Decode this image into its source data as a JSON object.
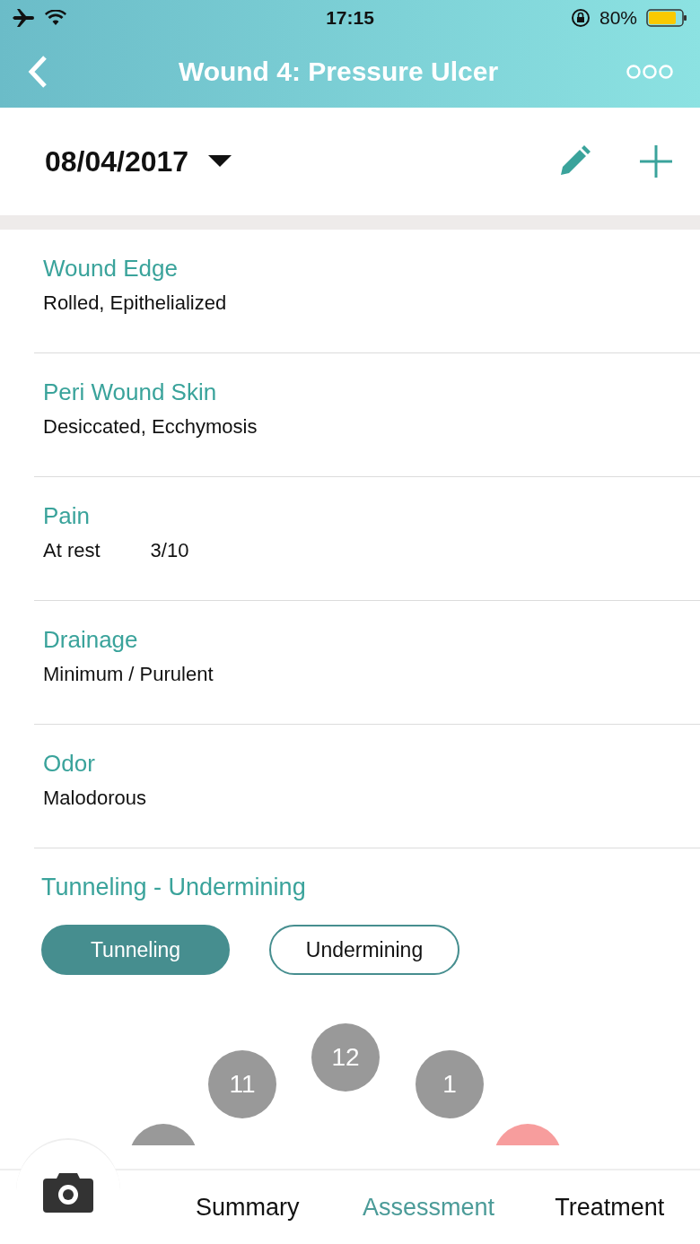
{
  "status_bar": {
    "time": "17:15",
    "battery_text": "80%"
  },
  "nav": {
    "title": "Wound 4: Pressure Ulcer"
  },
  "date_selector": {
    "value": "08/04/2017"
  },
  "fields": [
    {
      "label": "Wound Edge",
      "value": "Rolled, Epithelialized"
    },
    {
      "label": "Peri Wound Skin",
      "value": "Desiccated, Ecchymosis"
    },
    {
      "label": "Pain",
      "value": "At rest",
      "score": "3/10"
    },
    {
      "label": "Drainage",
      "value": "Minimum / Purulent"
    },
    {
      "label": "Odor",
      "value": "Malodorous"
    }
  ],
  "tunneling_section": {
    "title": "Tunneling - Undermining",
    "options": [
      {
        "label": "Tunneling",
        "selected": true
      },
      {
        "label": "Undermining",
        "selected": false
      }
    ],
    "clock_positions": [
      {
        "label": "11",
        "color": "#999999"
      },
      {
        "label": "12",
        "color": "#999999"
      },
      {
        "label": "1",
        "color": "#999999"
      },
      {
        "color": "#999999"
      },
      {
        "color": "#f79d9d"
      }
    ]
  },
  "tabs": [
    {
      "label": "Summary",
      "selected": false
    },
    {
      "label": "Assessment",
      "selected": true
    },
    {
      "label": "Treatment",
      "selected": false
    }
  ]
}
